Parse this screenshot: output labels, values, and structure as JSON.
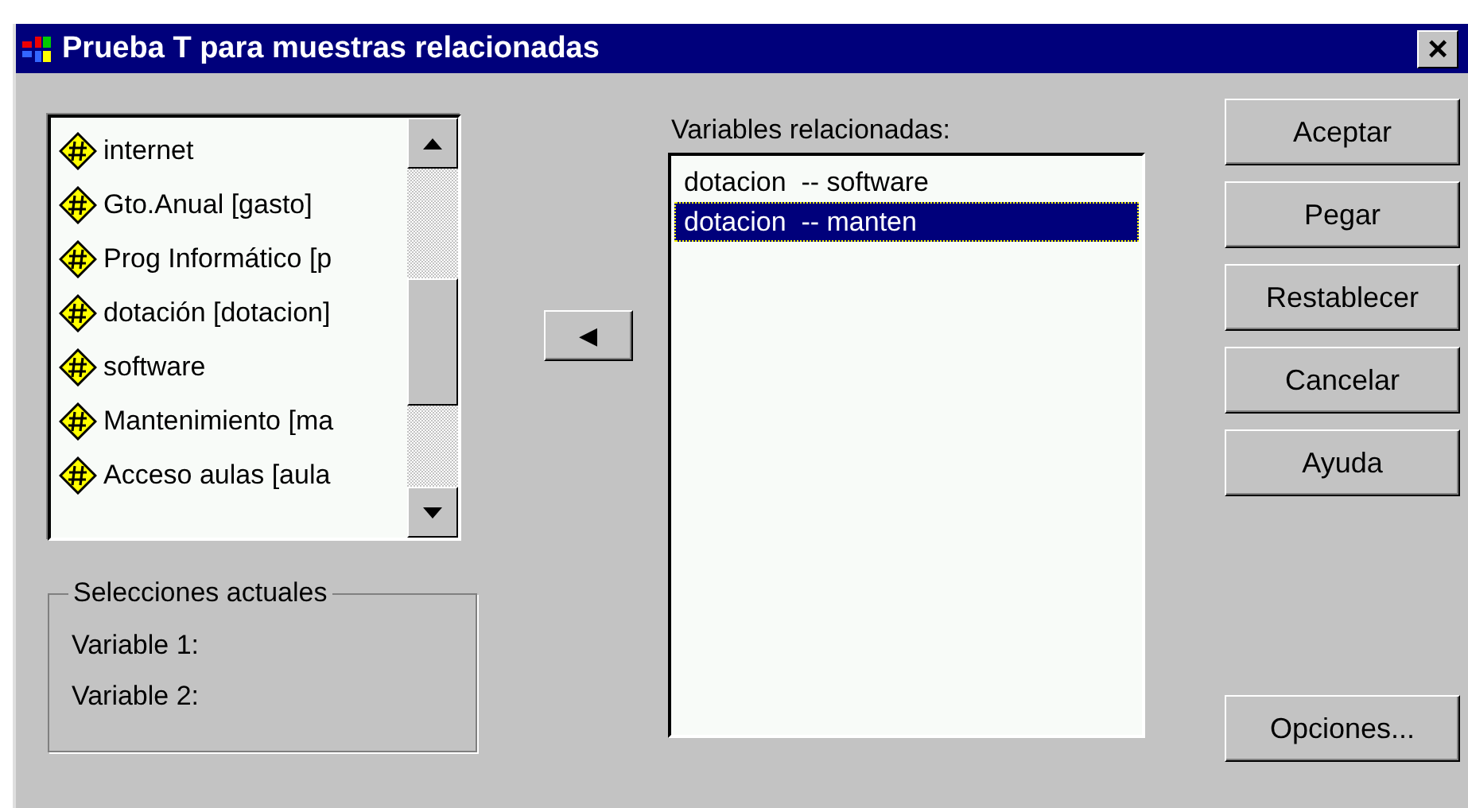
{
  "window": {
    "title": "Prueba T para muestras relacionadas",
    "close": "×"
  },
  "source_list": {
    "items": [
      {
        "label": "internet"
      },
      {
        "label": "Gto.Anual [gasto]"
      },
      {
        "label": "Prog Informático [p"
      },
      {
        "label": "dotación [dotacion]"
      },
      {
        "label": "software"
      },
      {
        "label": "Mantenimiento [ma"
      },
      {
        "label": "Acceso aulas [aula"
      }
    ]
  },
  "move_button": {
    "glyph": "◀"
  },
  "current_selections": {
    "title": "Selecciones actuales",
    "rows": [
      "Variable 1:",
      "Variable 2:"
    ]
  },
  "paired_list": {
    "label": "Variables relacionadas:",
    "items": [
      {
        "label": "dotacion  -- software",
        "selected": false
      },
      {
        "label": "dotacion  -- manten",
        "selected": true
      }
    ]
  },
  "buttons": [
    {
      "label": "Aceptar"
    },
    {
      "label": "Pegar"
    },
    {
      "label": "Restablecer"
    },
    {
      "label": "Cancelar"
    },
    {
      "label": "Ayuda"
    }
  ],
  "options_button": {
    "label": "Opciones..."
  }
}
